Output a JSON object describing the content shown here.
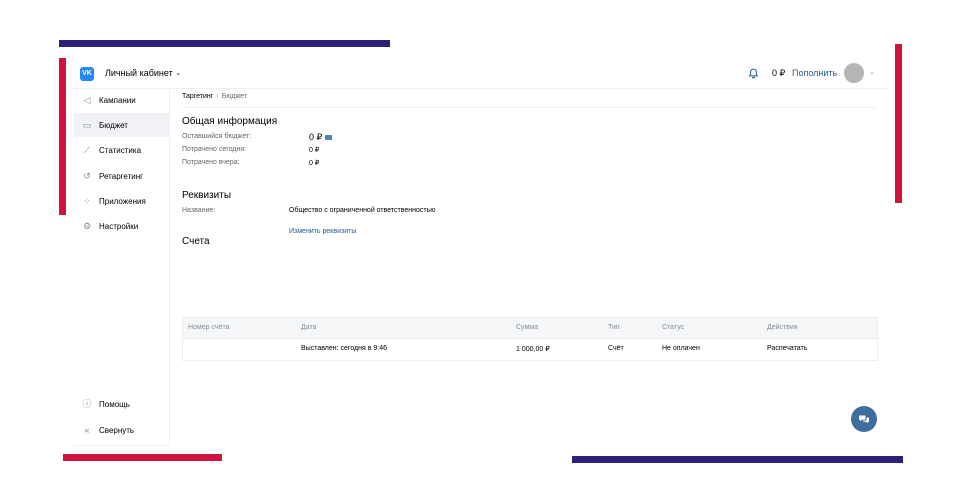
{
  "header": {
    "logo": "VK",
    "cabinet_title": "Личный кабинет",
    "balance": "0 ₽",
    "topup_label": "Пополнить"
  },
  "sidebar": {
    "items": [
      {
        "label": "Кампании",
        "icon": "megaphone-icon"
      },
      {
        "label": "Бюджет",
        "icon": "wallet-icon"
      },
      {
        "label": "Статистика",
        "icon": "chart-icon"
      },
      {
        "label": "Ретаргетинг",
        "icon": "retarget-icon"
      },
      {
        "label": "Приложения",
        "icon": "apps-icon"
      },
      {
        "label": "Настройки",
        "icon": "gear-icon"
      }
    ],
    "help_label": "Помощь",
    "collapse_label": "Свернуть"
  },
  "breadcrumb": {
    "root": "Таргетинг",
    "current": "Бюджет"
  },
  "general": {
    "title": "Общая информация",
    "rows": [
      {
        "label": "Оставшийся бюджет:",
        "value": "0 ₽"
      },
      {
        "label": "Потрачено сегодня:",
        "value": "0 ₽"
      },
      {
        "label": "Потрачено вчера:",
        "value": "0 ₽"
      }
    ]
  },
  "requisites": {
    "title": "Реквизиты",
    "name_label": "Название:",
    "name_value": "Общество с ограниченной ответственностью",
    "edit_link": "Изменить реквизиты"
  },
  "invoices": {
    "title": "Счета",
    "columns": [
      "Номер счёта",
      "Дата",
      "Сумма",
      "Тип",
      "Статус",
      "Действия"
    ],
    "rows": [
      {
        "number": "",
        "date": "Выставлен: сегодня в 9:46",
        "amount": "1 000,00 ₽",
        "type": "Счёт",
        "status": "Не оплачен",
        "action": "Распечатать"
      }
    ]
  },
  "colors": {
    "accent": "#2a5885",
    "brand": "#2787f5",
    "deco_red": "#d1123f",
    "deco_navy": "#2e1f7a"
  }
}
